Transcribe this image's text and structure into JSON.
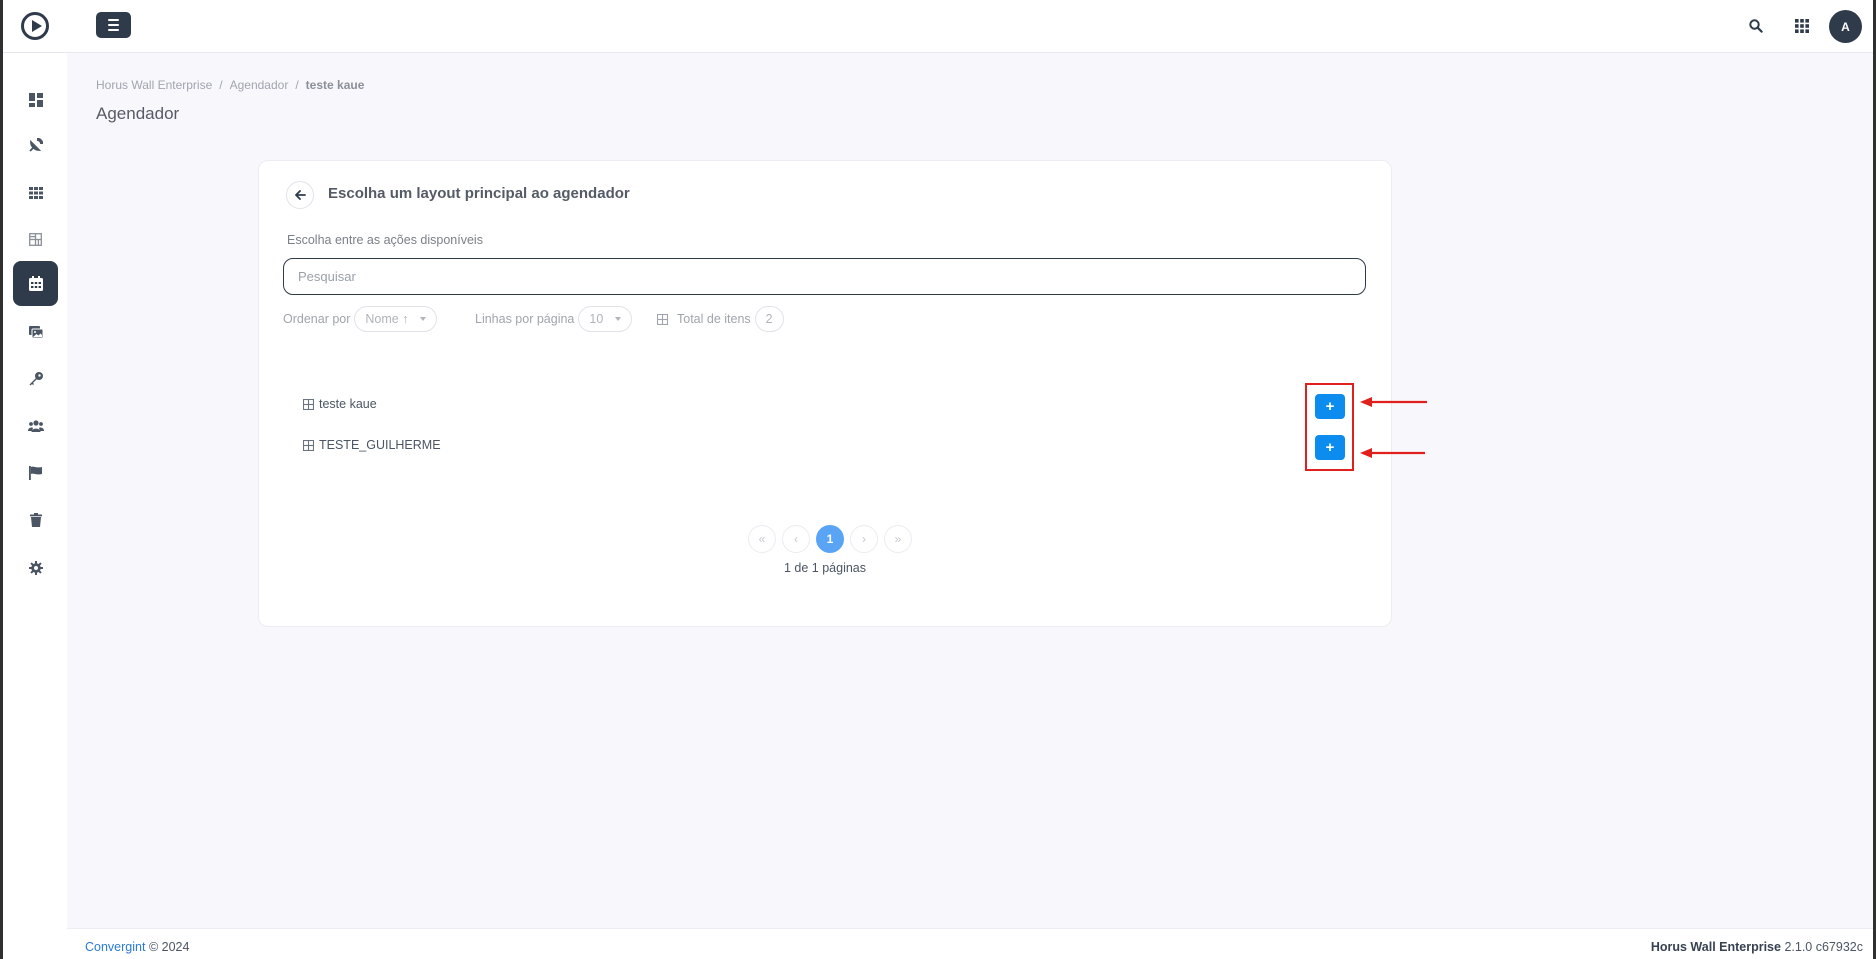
{
  "header": {
    "avatar_initial": "A",
    "icons": [
      "logo-play-icon",
      "menu-icon",
      "search-icon",
      "apps-grid-icon"
    ]
  },
  "sidebar": {
    "items": [
      {
        "name": "dashboard",
        "icon": "dashboard-icon",
        "active": false
      },
      {
        "name": "satellite",
        "icon": "satellite-icon",
        "active": false
      },
      {
        "name": "apps",
        "icon": "apps-icon",
        "active": false
      },
      {
        "name": "layouts",
        "icon": "layout-grid-icon",
        "active": false
      },
      {
        "name": "scheduler",
        "icon": "calendar-icon",
        "active": true
      },
      {
        "name": "media",
        "icon": "images-icon",
        "active": false
      },
      {
        "name": "keys",
        "icon": "key-icon",
        "active": false
      },
      {
        "name": "users",
        "icon": "users-icon",
        "active": false
      },
      {
        "name": "flags",
        "icon": "flag-icon",
        "active": false
      },
      {
        "name": "trash",
        "icon": "trash-icon",
        "active": false
      },
      {
        "name": "settings",
        "icon": "gear-icon",
        "active": false
      }
    ]
  },
  "breadcrumb": {
    "items": [
      "Horus Wall Enterprise",
      "Agendador",
      "teste kaue"
    ]
  },
  "page": {
    "title": "Agendador"
  },
  "card": {
    "title": "Escolha um layout principal ao agendador",
    "subtitle": "Escolha entre as ações disponíveis",
    "search_placeholder": "Pesquisar",
    "sort_label": "Ordenar por",
    "sort_value": "Nome ↑",
    "rows_label": "Linhas por página",
    "rows_value": "10",
    "total_label": "Total de itens",
    "total_value": "2",
    "items": [
      {
        "name": "teste kaue",
        "add_label": "+"
      },
      {
        "name": "TESTE_GUILHERME",
        "add_label": "+"
      }
    ],
    "pagination": {
      "first": "«",
      "prev": "‹",
      "current": "1",
      "next": "›",
      "last": "»",
      "summary": "1 de 1 páginas"
    }
  },
  "footer": {
    "company": "Convergint",
    "copyright": "© 2024",
    "product": "Horus Wall Enterprise",
    "version": "2.1.0 c67932c"
  },
  "colors": {
    "accent": "#0d8cf0",
    "dark": "#2f3a4a",
    "highlight": "#e0201c"
  }
}
